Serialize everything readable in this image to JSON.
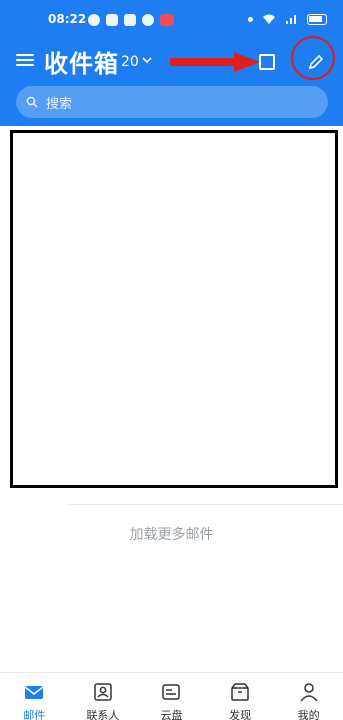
{
  "status_bar": {
    "time": "08:22"
  },
  "header": {
    "title": "收件箱",
    "count": "20",
    "search_placeholder": "搜索"
  },
  "content": {
    "load_more": "加载更多邮件"
  },
  "tabs": [
    {
      "label": "邮件",
      "icon": "mail-icon",
      "active": true
    },
    {
      "label": "联系人",
      "icon": "contacts-icon",
      "active": false
    },
    {
      "label": "云盘",
      "icon": "cloud-drive-icon",
      "active": false
    },
    {
      "label": "发现",
      "icon": "discover-icon",
      "active": false
    },
    {
      "label": "我的",
      "icon": "profile-icon",
      "active": false
    }
  ],
  "colors": {
    "brand": "#1e7df0",
    "annotation": "#e11e1e"
  }
}
